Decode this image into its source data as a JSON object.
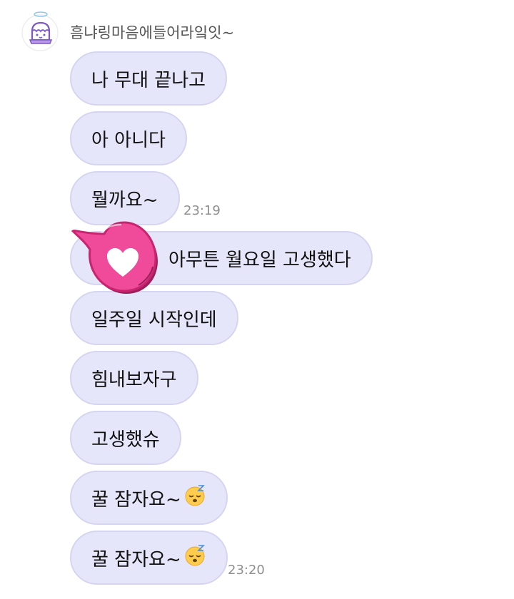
{
  "chat": {
    "sender_name": "흠냐링마음에들어라잌잇~",
    "messages": [
      {
        "text": "나 무대 끝나고"
      },
      {
        "text": "아 아니다"
      },
      {
        "text": "뭘까요~",
        "time": "23:19"
      },
      {
        "text": "아무튼 월요일 고생했다"
      },
      {
        "text": "일주일 시작인데"
      },
      {
        "text": "힘내보자구"
      },
      {
        "text": "고생했슈"
      },
      {
        "text": "꿀 잠자요~",
        "emoji": "sleeping-face-icon"
      },
      {
        "text": "꿀 잠자요~",
        "emoji": "sleeping-face-icon",
        "time": "23:20"
      }
    ]
  },
  "colors": {
    "bubble": "#e6e6fa",
    "bubble_border": "#d5d5f1",
    "heart_sticker": "#f04b9a",
    "timestamp": "#8f8f8f"
  },
  "icons": {
    "avatar": "cake-avatar-icon",
    "sticker": "heart-speech-sticker-icon"
  }
}
